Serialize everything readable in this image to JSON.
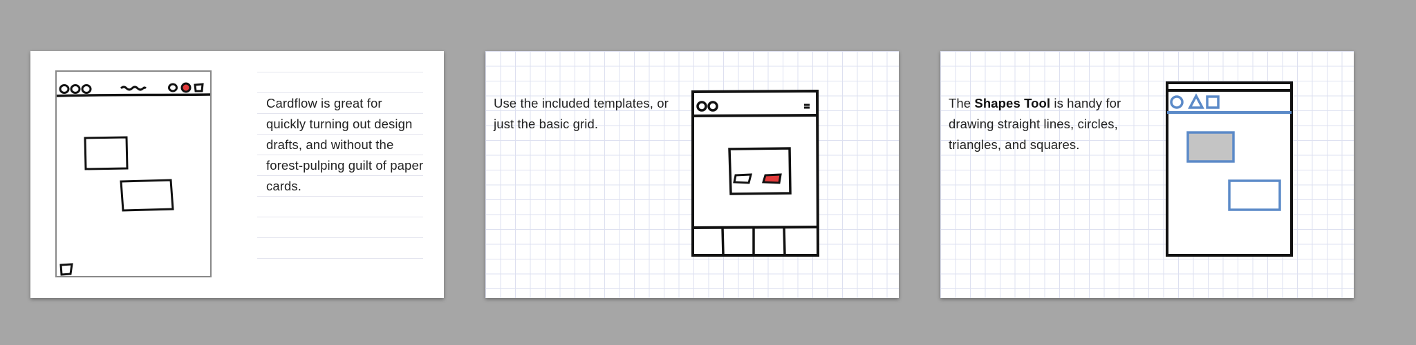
{
  "cards": [
    {
      "text": "Cardflow is great for quickly turning out design drafts, and without the forest-pulping guilt of paper cards."
    },
    {
      "text": "Use the included templates, or just the basic grid."
    },
    {
      "text_prefix": "The ",
      "text_bold": "Shapes Tool",
      "text_suffix": " is handy for drawing straight lines, circles, triangles, and squares."
    }
  ],
  "colors": {
    "background": "#a6a6a6",
    "card": "#ffffff",
    "grid_line": "#dde0f0",
    "sketch_ink": "#111111",
    "accent_red": "#e23b3b",
    "shape_blue": "#5b8ac8",
    "shape_fill_gray": "#c4c4c4"
  }
}
